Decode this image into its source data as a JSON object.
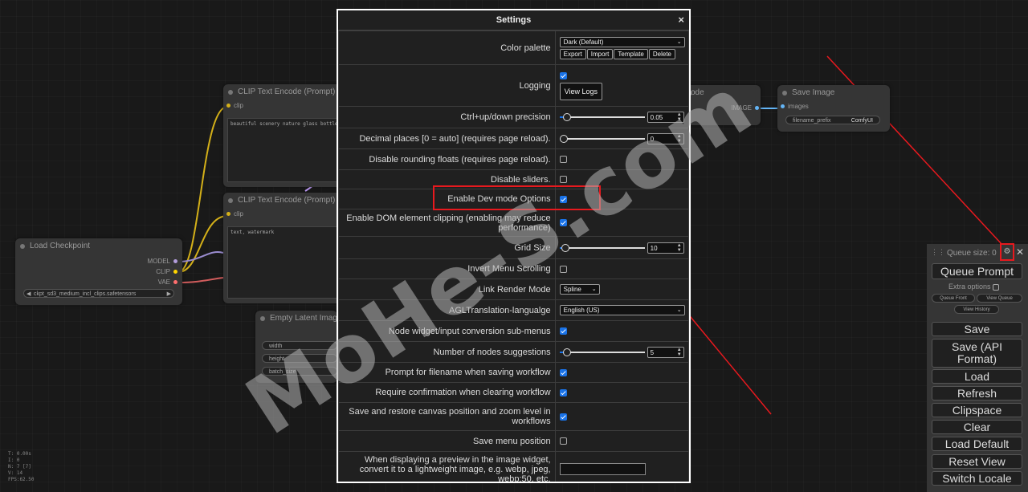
{
  "canvas": {
    "nodes": {
      "clip1": {
        "title": "CLIP Text Encode (Prompt)",
        "input": "clip",
        "text": "beautiful scenery nature glass bottle la"
      },
      "clip2": {
        "title": "CLIP Text Encode (Prompt)",
        "input": "clip",
        "text": "text, watermark"
      },
      "checkpoint": {
        "title": "Load Checkpoint",
        "outputs": [
          "MODEL",
          "CLIP",
          "VAE"
        ],
        "ckpt_value": "ckpt_sd3_medium_incl_clips.safetensors"
      },
      "latent": {
        "title": "Empty Latent Image",
        "widgets": [
          "width",
          "height",
          "batch_size"
        ]
      },
      "decode": {
        "title_fragment": "ode",
        "output": "IMAGE"
      },
      "save": {
        "title": "Save Image",
        "input": "images",
        "widget_label": "filename_prefix",
        "widget_value": "ComfyUI"
      }
    },
    "stats": [
      "T: 0.00s",
      "I: 0",
      "N: 7 [7]",
      "V: 14",
      "FPS:62.50"
    ]
  },
  "settings": {
    "title": "Settings",
    "close_icon": "×",
    "color_palette": {
      "label": "Color palette",
      "value": "Dark (Default)",
      "buttons": [
        "Export",
        "Import",
        "Template",
        "Delete"
      ]
    },
    "logging": {
      "label": "Logging",
      "checked": true,
      "button": "View Logs"
    },
    "precision": {
      "label": "Ctrl+up/down precision",
      "value": "0.05",
      "fraction": 0.05
    },
    "decimal": {
      "label": "Decimal places [0 = auto] (requires page reload).",
      "value": "0",
      "fraction": 0.0
    },
    "rounding": {
      "label": "Disable rounding floats (requires page reload).",
      "checked": false
    },
    "sliders": {
      "label": "Disable sliders.",
      "checked": false
    },
    "devmode": {
      "label": "Enable Dev mode Options",
      "checked": true
    },
    "domclip": {
      "label": "Enable DOM element clipping (enabling may reduce performance)",
      "checked": true
    },
    "grid": {
      "label": "Grid Size",
      "value": "10",
      "fraction": 0.02
    },
    "invert": {
      "label": "Invert Menu Scrolling",
      "checked": false
    },
    "linkmode": {
      "label": "Link Render Mode",
      "value": "Spline"
    },
    "agl": {
      "label": "AGLTranslation-langualge",
      "value": "English (US)"
    },
    "submenus": {
      "label": "Node widget/input conversion sub-menus",
      "checked": true
    },
    "suggestions": {
      "label": "Number of nodes suggestions",
      "value": "5",
      "fraction": 0.05
    },
    "prompt_filename": {
      "label": "Prompt for filename when saving workflow",
      "checked": true
    },
    "confirm_clear": {
      "label": "Require confirmation when clearing workflow",
      "checked": true
    },
    "save_canvas": {
      "label": "Save and restore canvas position and zoom level in workflows",
      "checked": true
    },
    "menu_position": {
      "label": "Save menu position",
      "checked": false
    },
    "preview": {
      "label": "When displaying a preview in the image widget, convert it to a lightweight image, e.g. webp, jpeg, webp;50, etc.",
      "value": ""
    }
  },
  "menu": {
    "queue_size": "Queue size: 0",
    "queue_prompt": "Queue Prompt",
    "extra_options": "Extra options",
    "small_buttons": [
      "Queue Front",
      "View Queue",
      "View History"
    ],
    "buttons": [
      "Save",
      "Save (API Format)",
      "Load",
      "Refresh",
      "Clipspace",
      "Clear",
      "Load Default",
      "Reset View",
      "Switch Locale"
    ]
  },
  "watermark": "MoHe-S.com",
  "colors": {
    "accent": "#1a73e8",
    "highlight": "#e8191e",
    "clip_link": "#ffd500",
    "model_link": "#b39ddb",
    "vae_link": "#ff6e6e"
  }
}
